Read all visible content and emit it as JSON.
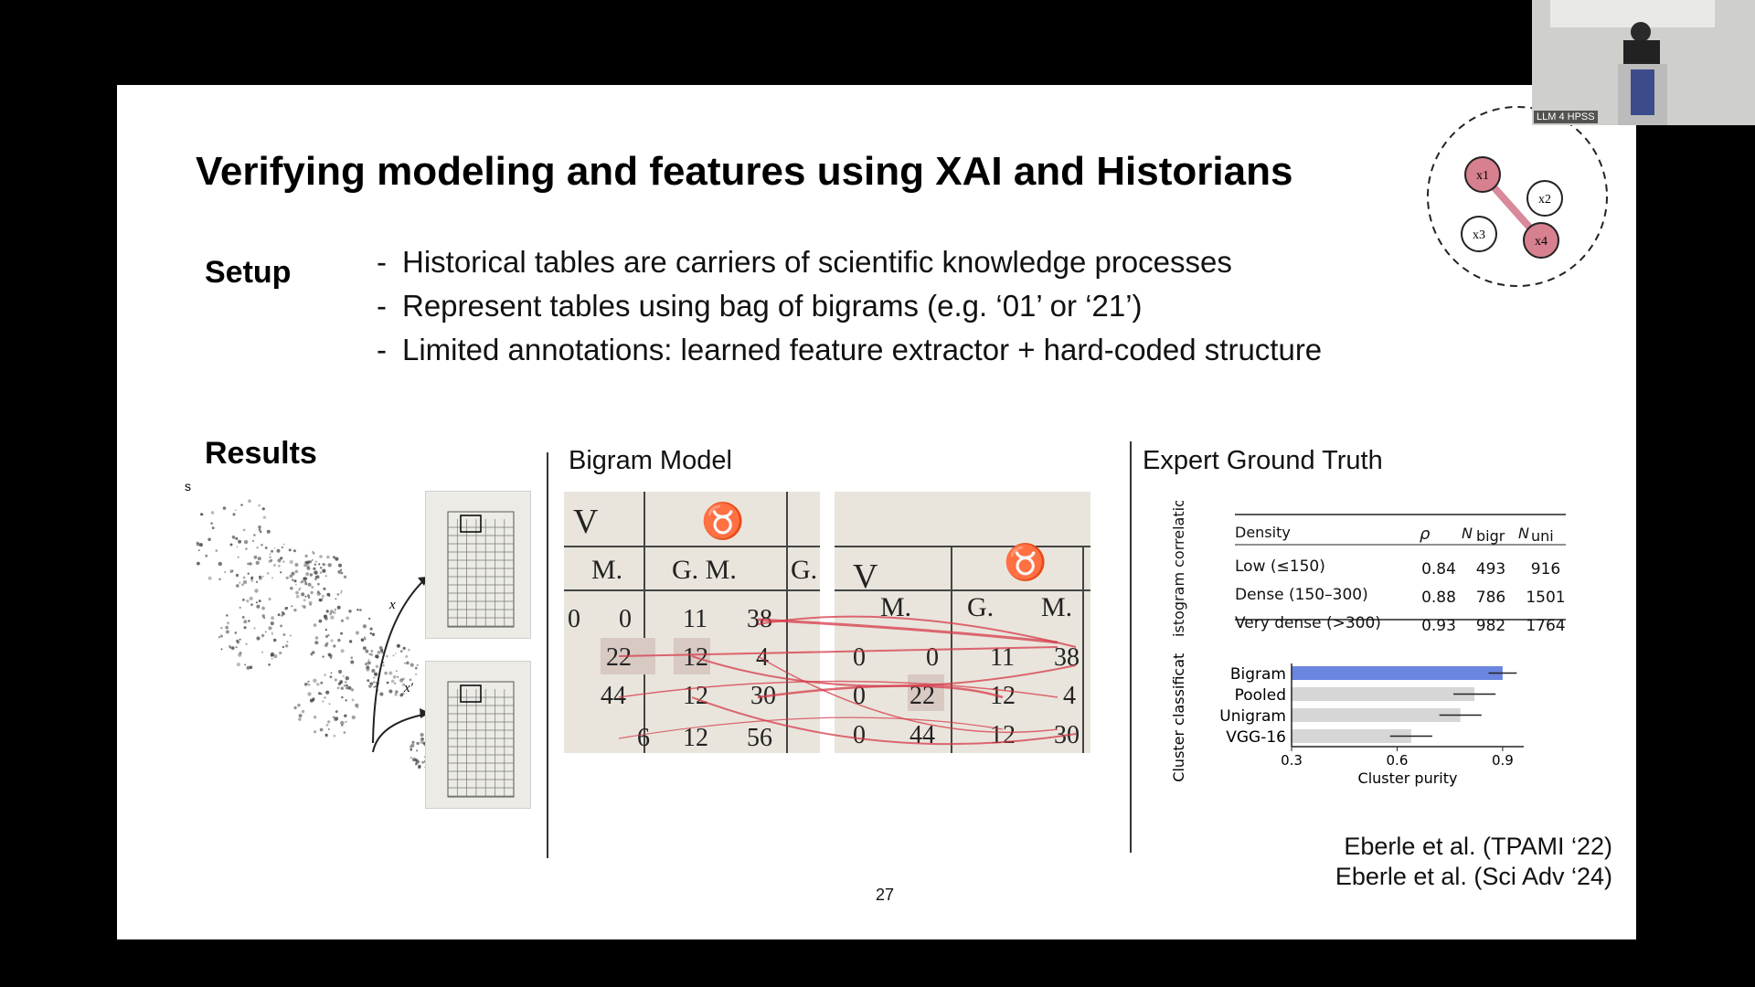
{
  "slide": {
    "title": "Verifying modeling and features using XAI and Historians",
    "setup_label": "Setup",
    "bullets": [
      "Historical tables are carriers of scientific knowledge processes",
      "Represent tables using bag of bigrams (e.g. ‘01’ or ‘21’)",
      "Limited annotations: learned feature extractor + hard-coded structure"
    ],
    "results_label": "Results",
    "bigram_title": "Bigram Model",
    "expert_title": "Expert Ground Truth",
    "scatter": {
      "corner_label": "s",
      "arrow_x": "x",
      "arrow_xp": "x′"
    },
    "table_crops": {
      "left": [
        "V",
        "♉",
        "M.",
        "G. M.",
        "G.",
        "0",
        "0",
        "11",
        "38",
        "22",
        "12",
        "4",
        "44",
        "12",
        "30",
        "6",
        "12",
        "56"
      ],
      "right": [
        "V",
        "♉",
        "M.",
        "G.",
        "M.",
        "0",
        "0",
        "11",
        "38",
        "0",
        "22",
        "12",
        "4",
        "0",
        "44",
        "12",
        "30"
      ]
    },
    "graph_nodes": [
      "x1",
      "x2",
      "x3",
      "x4"
    ],
    "density_table": {
      "side_label": "Histogram correlation",
      "headers": [
        "Density",
        "ρ",
        "N",
        "bigr",
        "N",
        "uni"
      ],
      "rows": [
        [
          "Low (≤150)",
          "0.84",
          "493",
          "916"
        ],
        [
          "Dense (150–300)",
          "0.88",
          "786",
          "1501"
        ],
        [
          "Very dense (>300)",
          "0.93",
          "982",
          "1764"
        ]
      ]
    },
    "page_number": "27",
    "citations": [
      "Eberle et al. (TPAMI ‘22)",
      "Eberle et al.  (Sci Adv ‘24)"
    ]
  },
  "chart_data": {
    "type": "bar",
    "orientation": "horizontal",
    "categories": [
      "Bigram",
      "Pooled",
      "Unigram",
      "VGG-16"
    ],
    "values": [
      0.9,
      0.82,
      0.78,
      0.64
    ],
    "errors": [
      0.04,
      0.06,
      0.06,
      0.06
    ],
    "colors": [
      "#6b86e0",
      "#d6d6d6",
      "#d6d6d6",
      "#d6d6d6"
    ],
    "xlabel": "Cluster purity",
    "ylabel": "Cluster classification",
    "xlim": [
      0.3,
      0.96
    ],
    "xticks": [
      "0.3",
      "0.6",
      "0.9"
    ]
  },
  "camera": {
    "label": "LLM 4 HPSS"
  }
}
